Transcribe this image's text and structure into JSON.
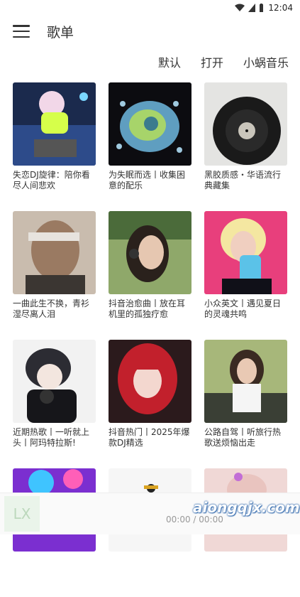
{
  "status": {
    "time": "12:04"
  },
  "appbar": {
    "title": "歌单"
  },
  "filters": [
    "默认",
    "打开",
    "小蜗音乐"
  ],
  "playlists": [
    {
      "title": "失恋DJ旋律：陪你看尽人间悲欢"
    },
    {
      "title": "为失眠而选丨收集困意的配乐"
    },
    {
      "title": "黑胶质感・华语流行典藏集"
    },
    {
      "title": "一曲此生不换，青衫湿尽离人泪"
    },
    {
      "title": "抖音治愈曲丨放在耳机里的孤独疗愈"
    },
    {
      "title": "小众英文丨遇见夏日的灵魂共鸣"
    },
    {
      "title": "近期热歌丨一听就上头丨阿玛特拉斯!"
    },
    {
      "title": "抖音热门丨2025年爆款DJ精选"
    },
    {
      "title": "公路自驾丨听旅行热歌送烦恼出走"
    },
    {
      "title": ""
    },
    {
      "title": ""
    },
    {
      "title": ""
    }
  ],
  "player": {
    "cover_text": "LX",
    "time": "00:00 / 00:00",
    "watermark": "aiongqjx.com"
  },
  "icons": [
    "menu-icon",
    "wifi-icon",
    "signal-icon",
    "battery-icon"
  ]
}
